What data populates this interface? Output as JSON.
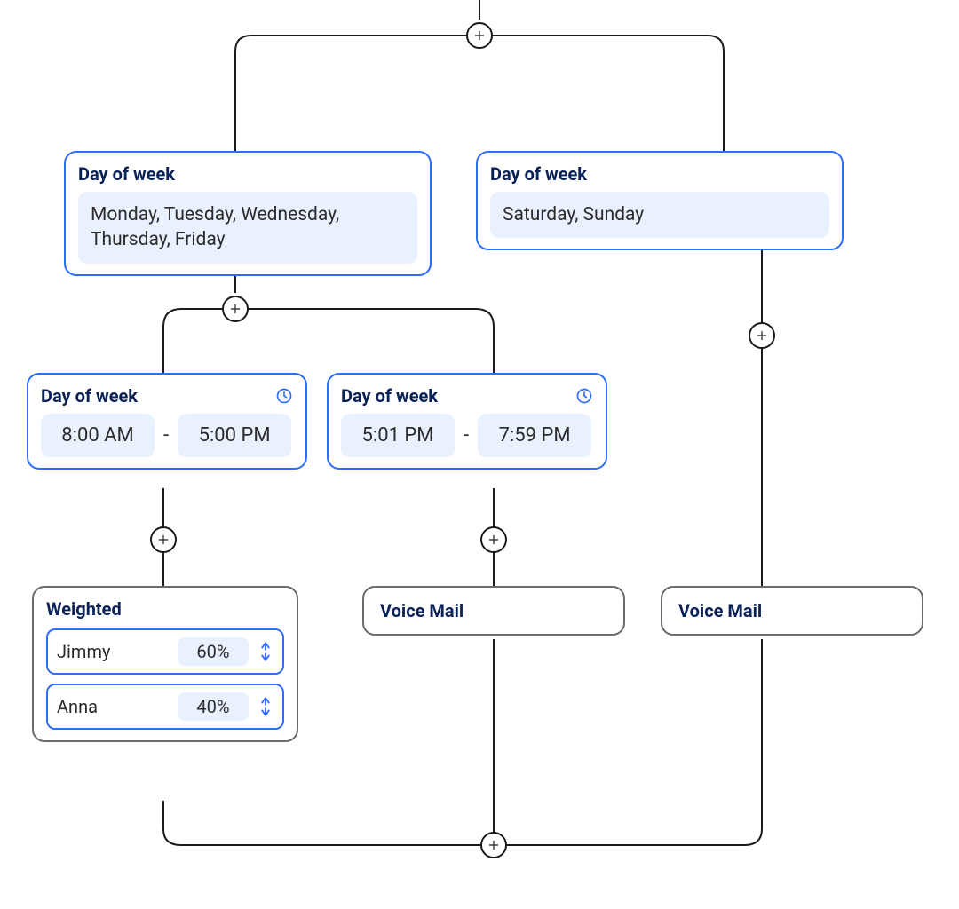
{
  "nodes": {
    "branch_weekdays": {
      "title": "Day of week",
      "value": "Monday, Tuesday, Wednesday, Thursday, Friday"
    },
    "branch_weekend": {
      "title": "Day of week",
      "value": "Saturday, Sunday"
    },
    "time_block_a": {
      "title": "Day of week",
      "start": "8:00 AM",
      "end": "5:00 PM"
    },
    "time_block_b": {
      "title": "Day of week",
      "start": "5:01 PM",
      "end": "7:59 PM"
    },
    "weighted": {
      "title": "Weighted",
      "items": [
        {
          "name": "Jimmy",
          "pct": "60%"
        },
        {
          "name": "Anna",
          "pct": "40%"
        }
      ]
    },
    "voicemail_a": {
      "title": "Voice Mail"
    },
    "voicemail_b": {
      "title": "Voice Mail"
    }
  },
  "separator": "-"
}
